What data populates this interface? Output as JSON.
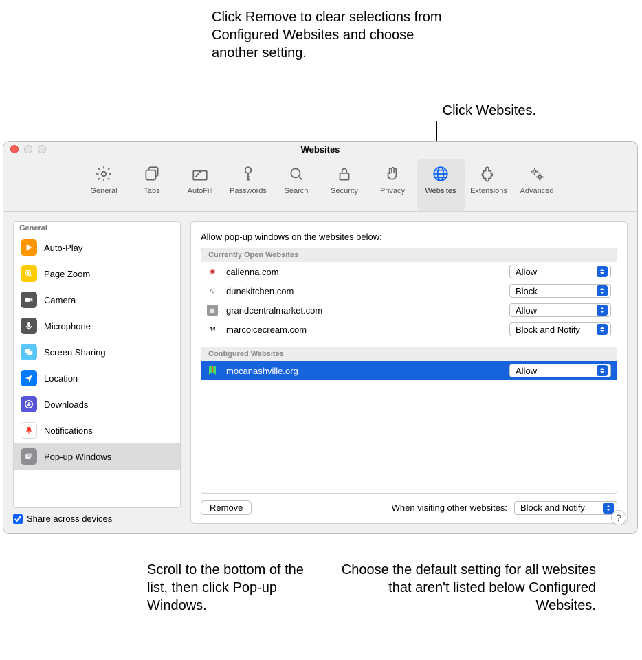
{
  "callouts": {
    "remove": "Click Remove to clear selections from Configured Websites and choose another setting.",
    "websites": "Click Websites.",
    "scroll": "Scroll to the bottom of the list, then click Pop-up Windows.",
    "default": "Choose the default setting for all websites that aren't listed below Configured Websites."
  },
  "window": {
    "title": "Websites"
  },
  "toolbar": [
    {
      "label": "General"
    },
    {
      "label": "Tabs"
    },
    {
      "label": "AutoFill"
    },
    {
      "label": "Passwords"
    },
    {
      "label": "Search"
    },
    {
      "label": "Security"
    },
    {
      "label": "Privacy"
    },
    {
      "label": "Websites"
    },
    {
      "label": "Extensions"
    },
    {
      "label": "Advanced"
    }
  ],
  "sidebar": {
    "sectionLabel": "General",
    "items": [
      {
        "label": "Auto-Play"
      },
      {
        "label": "Page Zoom"
      },
      {
        "label": "Camera"
      },
      {
        "label": "Microphone"
      },
      {
        "label": "Screen Sharing"
      },
      {
        "label": "Location"
      },
      {
        "label": "Downloads"
      },
      {
        "label": "Notifications"
      },
      {
        "label": "Pop-up Windows"
      }
    ]
  },
  "shareLabel": "Share across devices",
  "main": {
    "heading": "Allow pop-up windows on the websites below:",
    "openHeader": "Currently Open Websites",
    "configHeader": "Configured Websites",
    "open": [
      {
        "domain": "calienna.com",
        "value": "Allow"
      },
      {
        "domain": "dunekitchen.com",
        "value": "Block"
      },
      {
        "domain": "grandcentralmarket.com",
        "value": "Allow"
      },
      {
        "domain": "marcoicecream.com",
        "value": "Block and Notify"
      }
    ],
    "configured": [
      {
        "domain": "mocanashville.org",
        "value": "Allow"
      }
    ],
    "removeLabel": "Remove",
    "defaultLabel": "When visiting other websites:",
    "defaultValue": "Block and Notify"
  }
}
